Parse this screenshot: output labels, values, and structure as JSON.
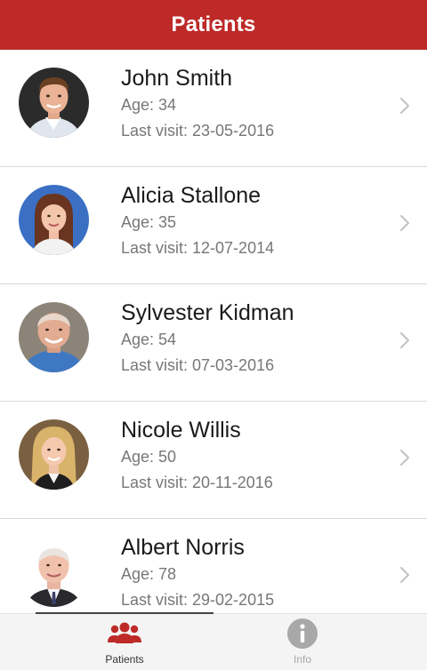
{
  "header": {
    "title": "Patients"
  },
  "patients": [
    {
      "name": "John Smith",
      "age": "Age: 34",
      "last_visit": "Last visit: 23-05-2016",
      "avatar": "man-young-photo"
    },
    {
      "name": "Alicia Stallone",
      "age": "Age: 35",
      "last_visit": "Last visit: 12-07-2014",
      "avatar": "woman-young-photo"
    },
    {
      "name": "Sylvester Kidman",
      "age": "Age: 54",
      "last_visit": "Last visit: 07-03-2016",
      "avatar": "man-bald-photo"
    },
    {
      "name": "Nicole Willis",
      "age": "Age: 50",
      "last_visit": "Last visit: 20-11-2016",
      "avatar": "woman-blonde-photo"
    },
    {
      "name": "Albert Norris",
      "age": "Age: 78",
      "last_visit": "Last visit: 29-02-2015",
      "avatar": "man-suit-photo"
    }
  ],
  "tabbar": {
    "tabs": [
      {
        "label": "Patients",
        "icon": "people-icon",
        "active": true
      },
      {
        "label": "Info",
        "icon": "info-icon",
        "active": false
      }
    ]
  },
  "colors": {
    "accent": "#bd2a28",
    "text_primary": "#1a1a1a",
    "text_secondary": "#777777",
    "tab_inactive": "#a8a8a8"
  }
}
